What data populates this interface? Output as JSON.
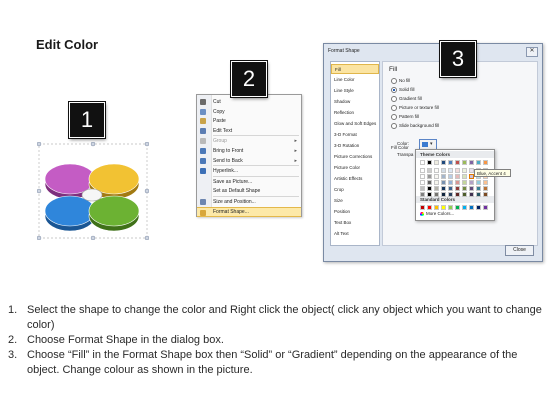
{
  "title": "Edit Color",
  "callouts": [
    "1",
    "2",
    "3"
  ],
  "context_menu": {
    "items": [
      {
        "label": "Cut",
        "icon": "scissors-icon",
        "color": "#6a6a6a"
      },
      {
        "label": "Copy",
        "icon": "copy-icon",
        "color": "#6b8fc4"
      },
      {
        "label": "Paste",
        "icon": "paste-icon",
        "color": "#c9a34a"
      },
      {
        "label": "Edit Text",
        "icon": "edit-text-icon",
        "color": "#5b7db3"
      },
      {
        "label": "Group",
        "icon": "group-icon",
        "color": "#b9b9b9",
        "disabled": true,
        "submenu": true
      },
      {
        "label": "Bring to Front",
        "icon": "bring-front-icon",
        "color": "#4b78b8",
        "submenu": true
      },
      {
        "label": "Send to Back",
        "icon": "send-back-icon",
        "color": "#4b78b8",
        "submenu": true
      },
      {
        "label": "Hyperlink...",
        "icon": "hyperlink-icon",
        "color": "#3c6fb6"
      },
      {
        "label": "Save as Picture...",
        "icon": "",
        "color": ""
      },
      {
        "label": "Set as Default Shape",
        "icon": "",
        "color": ""
      },
      {
        "label": "Size and Position...",
        "icon": "size-icon",
        "color": "#6d86b0"
      },
      {
        "label": "Format Shape...",
        "icon": "format-shape-icon",
        "color": "#d8a63a",
        "highlighted": true
      }
    ]
  },
  "dialog": {
    "title": "Format Shape",
    "nav": [
      "Fill",
      "Line Color",
      "Line Style",
      "Shadow",
      "Reflection",
      "Glow and Soft Edges",
      "3-D Format",
      "3-D Rotation",
      "Picture Corrections",
      "Picture Color",
      "Artistic Effects",
      "Crop",
      "Size",
      "Position",
      "Text Box",
      "Alt Text"
    ],
    "active_nav": "Fill",
    "pane_title": "Fill",
    "options": [
      "No fill",
      "Solid fill",
      "Gradient fill",
      "Picture or texture fill",
      "Pattern fill",
      "Slide background fill"
    ],
    "selected_option": "Solid fill",
    "fill_color_label": "Fill Color",
    "color_label": "Color:",
    "transparency_label": "Transpa",
    "close_label": "Close"
  },
  "color_picker": {
    "theme_label": "Theme Colors",
    "standard_label": "Standard Colors",
    "more_label": "More Colors...",
    "tooltip": "Blue, Accent 4",
    "theme_top": [
      "#ffffff",
      "#000000",
      "#eeece1",
      "#1f497d",
      "#4f81bd",
      "#c0504d",
      "#9bbb59",
      "#8064a2",
      "#4bacc6",
      "#f79646"
    ],
    "standard": [
      "#c00000",
      "#ff0000",
      "#ffc000",
      "#ffff00",
      "#92d050",
      "#00b050",
      "#00b0f0",
      "#0070c0",
      "#002060",
      "#7030a0"
    ]
  },
  "instructions": [
    {
      "num": "1.",
      "text": "Select the shape to change the color and Right click the object( click any object which you want to change color)"
    },
    {
      "num": "2.",
      "text": "Choose Format Shape in the dialog box."
    },
    {
      "num": "3.",
      "text": "Choose “Fill” in the Format Shape box then “Solid” or “Gradient” depending on the appearance of the object. Change colour as shown in the picture."
    }
  ]
}
